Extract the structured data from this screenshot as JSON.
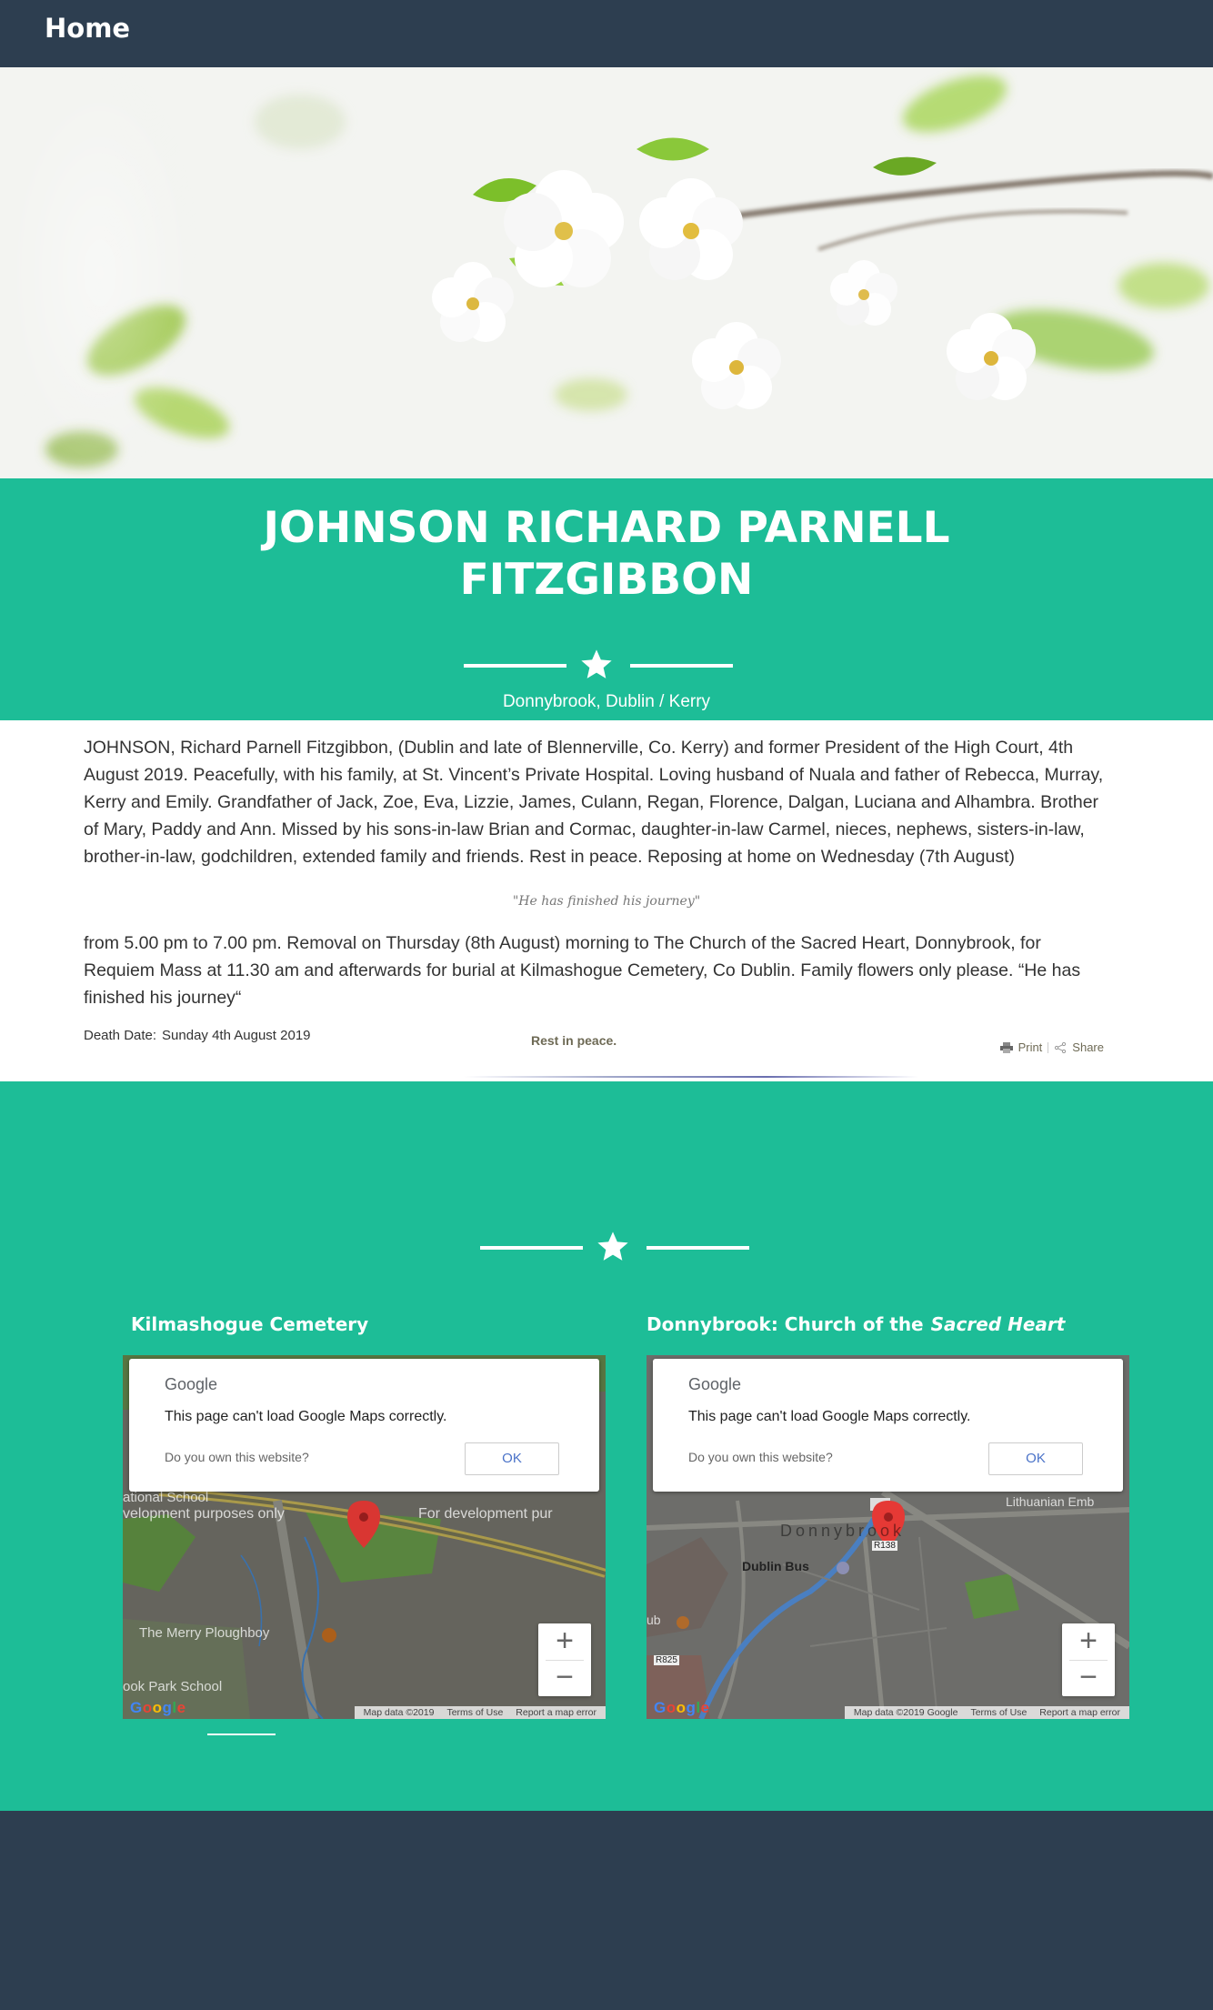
{
  "nav": {
    "home_label": "Home"
  },
  "deceased": {
    "name": "JOHNSON RICHARD PARNELL FITZGIBBON",
    "location": "Donnybrook, Dublin / Kerry"
  },
  "notice": {
    "paragraph_1": "JOHNSON, Richard Parnell Fitzgibbon, (Dublin and late of Blennerville, Co. Kerry) and former President of the High Court, 4th August 2019. Peacefully, with his family, at St. Vincent’s Private Hospital. Loving husband of Nuala and father of Rebecca, Murray, Kerry and Emily. Grandfather of Jack, Zoe, Eva, Lizzie, James, Culann, Regan, Florence, Dalgan, Luciana and Alhambra. Brother of Mary, Paddy and Ann. Missed by his sons-in-law Brian and Cormac, daughter-in-law Carmel, nieces, nephews, sisters-in-law, brother-in-law, godchildren, extended family and friends.   Rest in peace.   Reposing at home on Wednesday (7th August)",
    "quote": "\"He has finished his journey\"",
    "paragraph_2": "from 5.00 pm to 7.00 pm. Removal on Thursday (8th August) morning to The Church of the Sacred Heart, Donnybrook, for Requiem Mass at 11.30 am and afterwards for burial at Kilmashogue Cemetery, Co Dublin. Family flowers only please.   “He has finished his journey“",
    "death_date_label": "Death Date:",
    "death_date_value": "Sunday 4th August 2019",
    "rest_in_peace": "Rest in peace.",
    "print_label": "Print",
    "share_label": "Share"
  },
  "maps": [
    {
      "title": "Kilmashogue Cemetery",
      "title_emphasis": "",
      "dialog_logo": "Google",
      "dialog_message": "This page can't load Google Maps correctly.",
      "dialog_question": "Do you own this website?",
      "dialog_ok": "OK",
      "labels": [
        "ational School",
        "velopment purposes only",
        "For development pur",
        "The Merry Ploughboy",
        "ook Park School"
      ],
      "footer": [
        "Map data ©2019",
        "Terms of Use",
        "Report a map error"
      ]
    },
    {
      "title": "Donnybrook: Church of the",
      "title_emphasis": "Sacred Heart",
      "dialog_logo": "Google",
      "dialog_message": "This page can't load Google Maps correctly.",
      "dialog_question": "Do you own this website?",
      "dialog_ok": "OK",
      "labels": [
        "Lithuanian Emb",
        "Donnybrook",
        "Dublin Bus",
        "R138",
        "R825",
        "ub"
      ],
      "footer": [
        "Map data ©2019 Google",
        "Terms of Use",
        "Report a map error"
      ]
    }
  ],
  "zoom": {
    "in": "+",
    "out": "−"
  },
  "google_mark": [
    "G",
    "o",
    "o",
    "g",
    "l",
    "e"
  ],
  "colors": {
    "accent": "#1dbd97",
    "navy": "#2d3e50",
    "white": "#ffffff"
  }
}
